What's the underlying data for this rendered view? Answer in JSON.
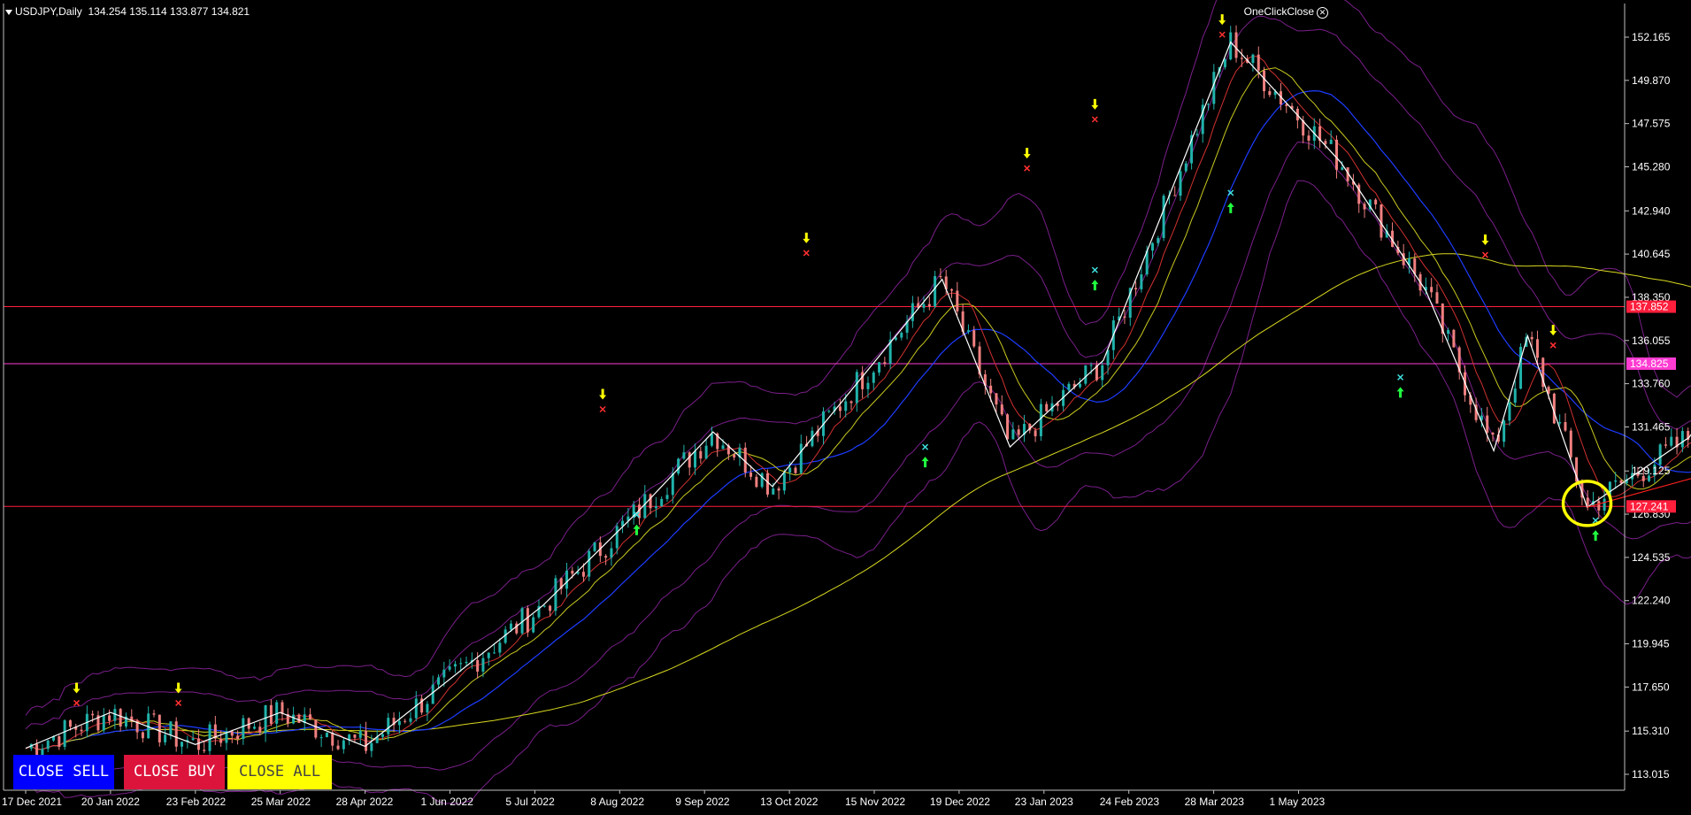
{
  "header": {
    "symbol": "USDJPY,Daily",
    "ohlc": "134.254 135.114 133.877 134.821",
    "oneclick_label": "OneClickClose"
  },
  "buttons": {
    "close_sell": "CLOSE SELL",
    "close_buy": "CLOSE BUY",
    "close_all": "CLOSE ALL"
  },
  "colors": {
    "background": "#000000",
    "grid_border": "#c0c0c0",
    "h_line": "#ff1e3c",
    "current_line": "#ff3cd2",
    "bull_candle": "#20b2aa",
    "bear_candle": "#f08080",
    "zigzag": "#ffffff",
    "ma_slow": "#d8d820",
    "highlight": "#ffff00"
  },
  "chart_data": {
    "type": "candlestick",
    "y_axis": {
      "min": 113.015,
      "max": 152.165,
      "ticks": [
        152.165,
        149.87,
        147.575,
        145.28,
        142.94,
        140.645,
        138.35,
        136.055,
        133.76,
        131.465,
        129.125,
        126.83,
        124.535,
        122.24,
        119.945,
        117.65,
        115.31,
        113.015
      ],
      "price_labels": [
        {
          "value": 137.852,
          "label": "137.852",
          "color": "#ff1e3c"
        },
        {
          "value": 134.825,
          "label": "134.825",
          "color": "#ff3cd2"
        },
        {
          "value": 127.241,
          "label": "127.241",
          "color": "#ff1e3c"
        }
      ]
    },
    "x_axis": {
      "labels": [
        "17 Dec 2021",
        "20 Jan 2022",
        "23 Feb 2022",
        "25 Mar 2022",
        "28 Apr 2022",
        "1 Jun 2022",
        "5 Jul 2022",
        "8 Aug 2022",
        "9 Sep 2022",
        "13 Oct 2022",
        "15 Nov 2022",
        "19 Dec 2022",
        "23 Jan 2023",
        "24 Feb 2023",
        "28 Mar 2023",
        "1 May 2023"
      ]
    },
    "horizontal_lines": [
      137.852,
      134.825,
      127.241
    ],
    "zigzag": [
      [
        0,
        114.4
      ],
      [
        1,
        116.3
      ],
      [
        2,
        114.6
      ],
      [
        3,
        116.3
      ],
      [
        4,
        114.5
      ],
      [
        6.1,
        122.0
      ],
      [
        7.2,
        126.9
      ],
      [
        8.1,
        131.2
      ],
      [
        8.8,
        128.3
      ],
      [
        10.8,
        139.3
      ],
      [
        11.6,
        130.4
      ],
      [
        12.7,
        135.0
      ],
      [
        14.2,
        151.9
      ],
      [
        15.5,
        145.5
      ],
      [
        16.5,
        138.7
      ],
      [
        17.3,
        130.2
      ],
      [
        17.7,
        136.3
      ],
      [
        18.4,
        127.2
      ],
      [
        19.6,
        130.9
      ],
      [
        20.7,
        137.6
      ],
      [
        21.2,
        133.9
      ],
      [
        21.6,
        129.7
      ],
      [
        22.6,
        133.8
      ],
      [
        23.4,
        137.7
      ],
      [
        23.6,
        134.8
      ]
    ],
    "trend_line": {
      "from": [
        18.4,
        127.2
      ],
      "to": [
        25,
        135.4
      ]
    },
    "pivot_arrows_down": [
      [
        0.6,
        117.6
      ],
      [
        1.8,
        117.6
      ],
      [
        6.8,
        133.2
      ],
      [
        9.2,
        141.5
      ],
      [
        11.8,
        146.0
      ],
      [
        12.6,
        148.6
      ],
      [
        14.1,
        153.1
      ],
      [
        17.2,
        141.4
      ],
      [
        18.0,
        136.6
      ],
      [
        20.2,
        139.9
      ],
      [
        23.0,
        139.8
      ]
    ],
    "pivot_arrows_up": [
      [
        7.2,
        126.0
      ],
      [
        10.6,
        129.6
      ],
      [
        12.6,
        139.0
      ],
      [
        14.2,
        143.1
      ],
      [
        16.2,
        133.3
      ],
      [
        18.5,
        125.7
      ],
      [
        21.1,
        129.7
      ]
    ],
    "circles": [
      [
        18.4,
        127.4
      ],
      [
        20.9,
        137.9
      ],
      [
        21.6,
        129.9
      ],
      [
        23.0,
        137.8
      ]
    ],
    "projection_arrows": [
      {
        "color": "#ff2020",
        "from": [
          23.8,
          131.9
        ],
        "to": [
          24.6,
          136.4
        ]
      },
      {
        "color": "#20c020",
        "from": [
          23.3,
          134.3
        ],
        "to": [
          23.8,
          131.4
        ]
      },
      {
        "color": "#3c3cdc",
        "from": [
          23.7,
          131.0
        ],
        "to": [
          24.2,
          127.0
        ]
      }
    ]
  }
}
